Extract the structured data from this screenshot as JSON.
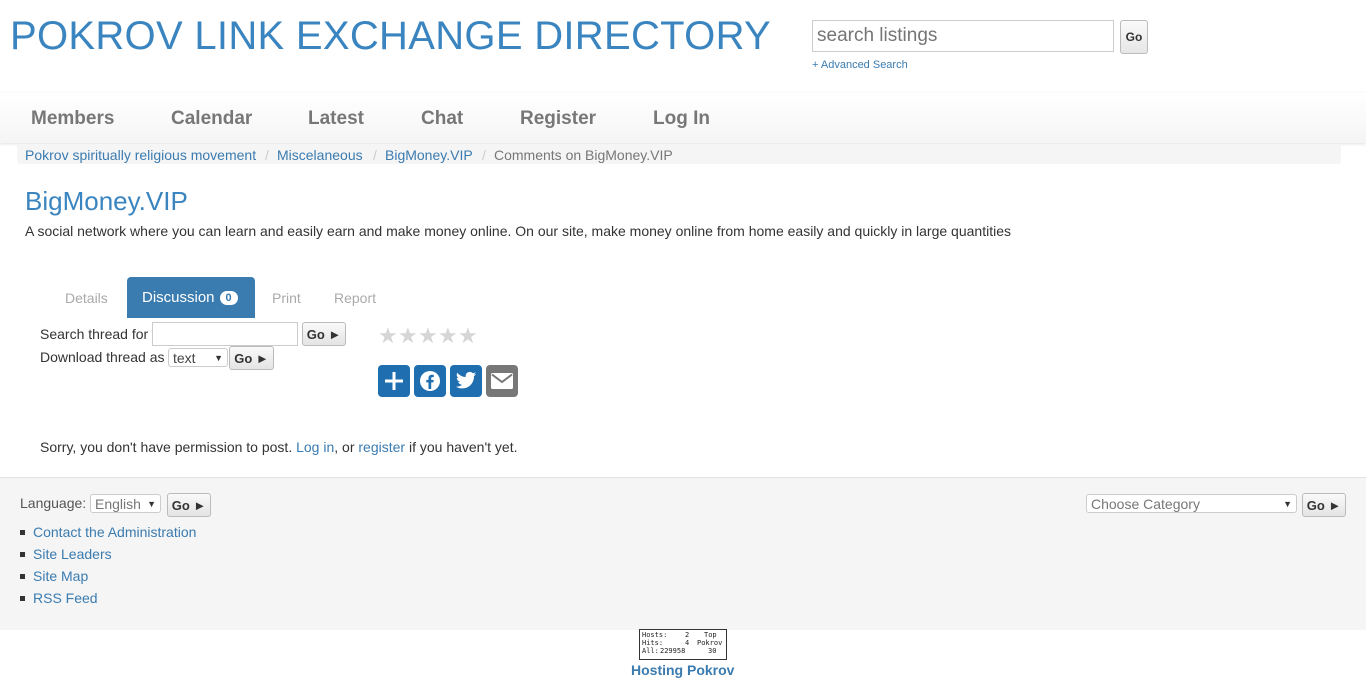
{
  "header": {
    "site_title": "POKROV LINK EXCHANGE DIRECTORY",
    "search_placeholder": "search listings",
    "search_go": "Go",
    "advanced_search": "+ Advanced Search"
  },
  "nav": {
    "members": "Members",
    "calendar": "Calendar",
    "latest": "Latest",
    "chat": "Chat",
    "register": "Register",
    "login": "Log In"
  },
  "breadcrumb": {
    "items": [
      "Pokrov spiritually religious movement",
      "Miscelaneous",
      "BigMoney.VIP",
      "Comments on BigMoney.VIP"
    ],
    "separator": "/"
  },
  "listing": {
    "title": "BigMoney.VIP",
    "description": "A social network where you can learn and easily earn and make money online. On our site, make money online from home easily and quickly in large quantities"
  },
  "tabs": {
    "details": "Details",
    "discussion": "Discussion",
    "discussion_count": "0",
    "print": "Print",
    "report": "Report"
  },
  "thread": {
    "search_label": "Search thread for",
    "go": "Go ►",
    "download_label": "Download thread as",
    "format_selected": "text",
    "rating_max": 5,
    "rating_value": 0
  },
  "share": {
    "icons": [
      "share-icon",
      "facebook-icon",
      "twitter-icon",
      "email-icon"
    ],
    "brand_color": "#1f6fb0"
  },
  "permission": {
    "prefix": "Sorry, you don't have permission to post. ",
    "login": "Log in",
    "middle": ", or ",
    "register": "register",
    "suffix": " if you haven't yet."
  },
  "footer": {
    "language_label": "Language:",
    "language_selected": "English",
    "go": "Go ►",
    "category_selected": "Choose Category",
    "links": [
      "Contact the Administration",
      "Site Leaders",
      "Site Map",
      "RSS Feed"
    ],
    "counter": {
      "hosts_label": "Hosts:",
      "hosts": "2",
      "hits_label": "Hits:",
      "hits": "4",
      "all_label": "All:",
      "all": "229958",
      "top_label": "Top",
      "top_name": "Pokrov",
      "top_rank": "30"
    },
    "hosting": "Hosting Pokrov"
  }
}
